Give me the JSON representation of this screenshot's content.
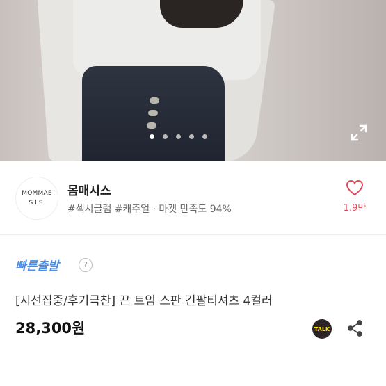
{
  "gallery": {
    "page_count": 5,
    "active_index": 0
  },
  "shop": {
    "logo_line1": "MOMMAE",
    "logo_line2": "SIS",
    "name": "몸매시스",
    "tags": "#섹시글램 #캐주얼 · 마켓 만족도 94%",
    "like_count": "1.9만"
  },
  "product": {
    "fast_label": "빠른출발",
    "help_label": "?",
    "title": "[시선집중/후기극찬] 끈 트임 스판 긴팔티셔츠 4컬러",
    "price": "28,300원"
  },
  "actions": {
    "talk_label": "TALK"
  },
  "icons": {
    "expand": "expand-icon",
    "heart": "heart-icon",
    "talk": "kakao-talk-icon",
    "share": "share-icon"
  },
  "colors": {
    "accent_blue": "#4a8de8",
    "like_red": "#e04a5a",
    "talk_yellow": "#fbe300"
  }
}
